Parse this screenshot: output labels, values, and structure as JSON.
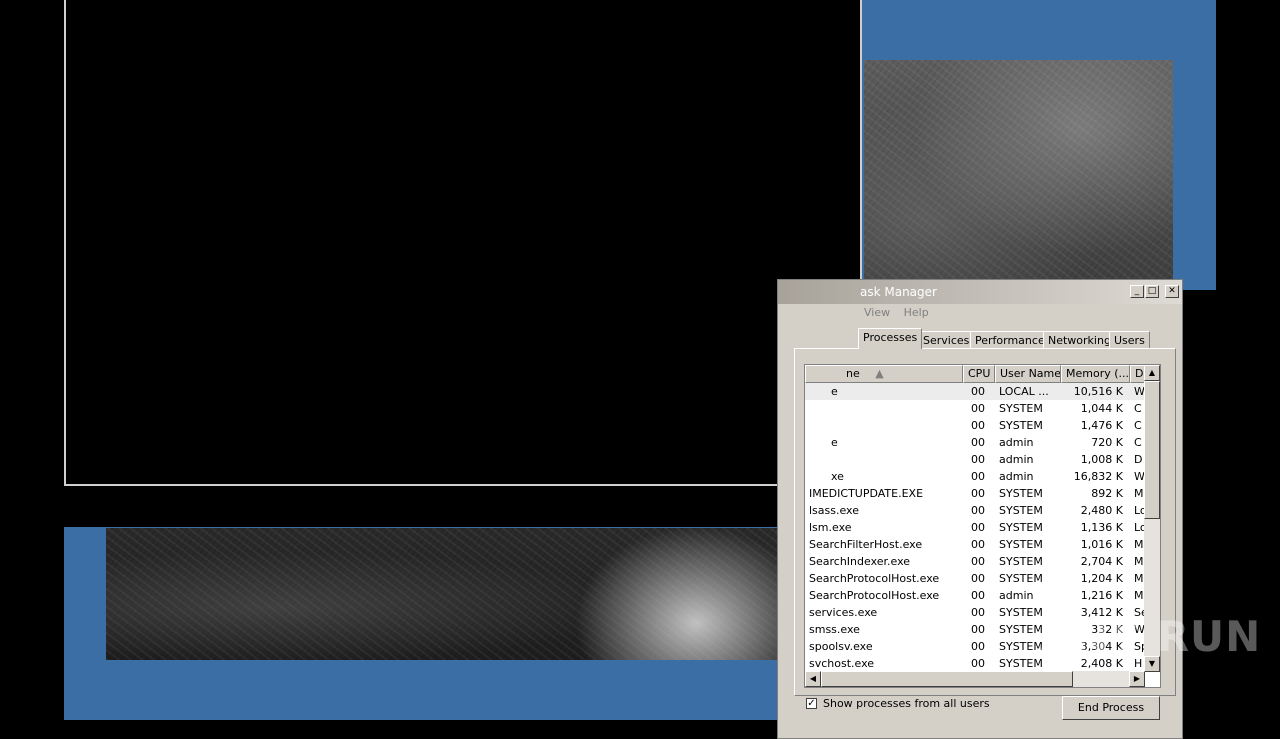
{
  "taskmanager": {
    "title": "Windows Task Manager",
    "title_visible": "ask Manager",
    "menu": [
      "View",
      "Help"
    ],
    "tabs": [
      "Processes",
      "Services",
      "Performance",
      "Networking",
      "Users"
    ],
    "active_tab": "Processes",
    "columns": {
      "name": "Image Name",
      "name_visible": "ne",
      "cpu": "CPU",
      "user": "User Name",
      "memory": "Memory (...",
      "desc": "D"
    },
    "rows": [
      {
        "name": "e",
        "cpu": "00",
        "user": "LOCAL ...",
        "mem": "10,516 K",
        "desc": "W"
      },
      {
        "name": "",
        "cpu": "00",
        "user": "SYSTEM",
        "mem": "1,044 K",
        "desc": "C"
      },
      {
        "name": "",
        "cpu": "00",
        "user": "SYSTEM",
        "mem": "1,476 K",
        "desc": "C"
      },
      {
        "name": "e",
        "cpu": "00",
        "user": "admin",
        "mem": "720 K",
        "desc": "C"
      },
      {
        "name": "",
        "cpu": "00",
        "user": "admin",
        "mem": "1,008 K",
        "desc": "D"
      },
      {
        "name": "xe",
        "cpu": "00",
        "user": "admin",
        "mem": "16,832 K",
        "desc": "W"
      },
      {
        "name": "IMEDICTUPDATE.EXE",
        "cpu": "00",
        "user": "SYSTEM",
        "mem": "892 K",
        "desc": "M"
      },
      {
        "name": "lsass.exe",
        "cpu": "00",
        "user": "SYSTEM",
        "mem": "2,480 K",
        "desc": "Lo"
      },
      {
        "name": "lsm.exe",
        "cpu": "00",
        "user": "SYSTEM",
        "mem": "1,136 K",
        "desc": "Lo"
      },
      {
        "name": "SearchFilterHost.exe",
        "cpu": "00",
        "user": "SYSTEM",
        "mem": "1,016 K",
        "desc": "M"
      },
      {
        "name": "SearchIndexer.exe",
        "cpu": "00",
        "user": "SYSTEM",
        "mem": "2,704 K",
        "desc": "M"
      },
      {
        "name": "SearchProtocolHost.exe",
        "cpu": "00",
        "user": "SYSTEM",
        "mem": "1,204 K",
        "desc": "M"
      },
      {
        "name": "SearchProtocolHost.exe",
        "cpu": "00",
        "user": "admin",
        "mem": "1,216 K",
        "desc": "M"
      },
      {
        "name": "services.exe",
        "cpu": "00",
        "user": "SYSTEM",
        "mem": "3,412 K",
        "desc": "Se"
      },
      {
        "name": "smss.exe",
        "cpu": "00",
        "user": "SYSTEM",
        "mem": "332 K",
        "desc": "W"
      },
      {
        "name": "spoolsv.exe",
        "cpu": "00",
        "user": "SYSTEM",
        "mem": "3,304 K",
        "desc": "Sp"
      },
      {
        "name": "svchost.exe",
        "cpu": "00",
        "user": "SYSTEM",
        "mem": "2,408 K",
        "desc": "H"
      }
    ],
    "show_all_label": "Show processes from all users",
    "show_all_checked": true,
    "end_process_label": "End Process"
  },
  "watermark": "ANY RUN"
}
